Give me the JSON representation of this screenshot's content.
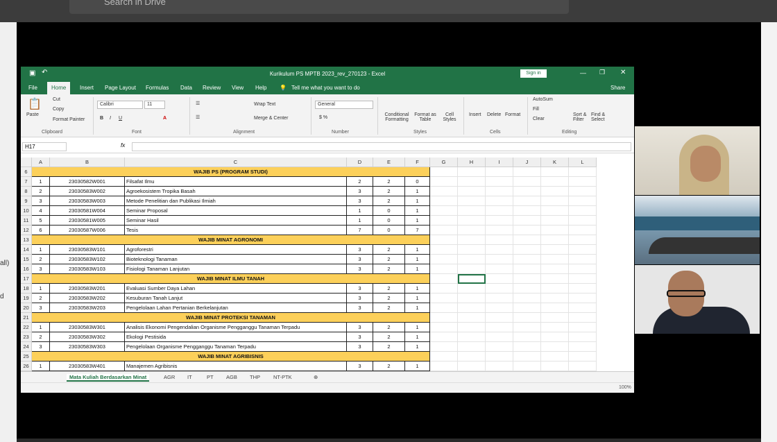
{
  "meet": {
    "search_placeholder": "Search in Drive",
    "left_labels": [
      "all)",
      "d"
    ]
  },
  "excel": {
    "title": "Kurikulum PS MPTB 2023_rev_270123 - Excel",
    "signin": "Sign in",
    "tabs": [
      "File",
      "Home",
      "Insert",
      "Page Layout",
      "Formulas",
      "Data",
      "Review",
      "View",
      "Help"
    ],
    "tell_me": "Tell me what you want to do",
    "share": "Share",
    "ribbon": {
      "paste": "Paste",
      "cut": "Cut",
      "copy": "Copy",
      "format_painter": "Format Painter",
      "font_name": "Calibri",
      "font_size": "11",
      "wrap_text": "Wrap Text",
      "merge_center": "Merge & Center",
      "number_format": "General",
      "conditional": "Conditional Formatting",
      "format_table": "Format as Table",
      "cell_styles": "Cell Styles",
      "insert": "Insert",
      "delete": "Delete",
      "format": "Format",
      "autosum": "AutoSum",
      "fill": "Fill",
      "clear": "Clear",
      "sort": "Sort & Filter",
      "find": "Find & Select",
      "groups": [
        "Clipboard",
        "Font",
        "Alignment",
        "Number",
        "Styles",
        "Cells",
        "Editing"
      ]
    },
    "namebox": "H17",
    "columns": [
      "A",
      "B",
      "C",
      "D",
      "E",
      "F",
      "G",
      "H",
      "I",
      "J",
      "K",
      "L"
    ],
    "rows": [
      {
        "n": "6",
        "section": "WAJIB PS (PROGRAM STUDI)"
      },
      {
        "n": "7",
        "a": "1",
        "b": "23030582W001",
        "c": "Filsafat Ilmu",
        "d": "2",
        "e": "2",
        "f": "0"
      },
      {
        "n": "8",
        "a": "2",
        "b": "23030583W002",
        "c": "Agroekosistem Tropika Basah",
        "d": "3",
        "e": "2",
        "f": "1"
      },
      {
        "n": "9",
        "a": "3",
        "b": "23030583W003",
        "c": "Metode Penelitian dan Publikasi Ilmiah",
        "d": "3",
        "e": "2",
        "f": "1"
      },
      {
        "n": "10",
        "a": "4",
        "b": "23030581W004",
        "c": "Seminar Proposal",
        "d": "1",
        "e": "0",
        "f": "1"
      },
      {
        "n": "11",
        "a": "5",
        "b": "23030581W005",
        "c": "Seminar Hasil",
        "d": "1",
        "e": "0",
        "f": "1"
      },
      {
        "n": "12",
        "a": "6",
        "b": "23030587W006",
        "c": "Tesis",
        "d": "7",
        "e": "0",
        "f": "7"
      },
      {
        "n": "13",
        "section": "WAJIB MINAT AGRONOMI"
      },
      {
        "n": "14",
        "a": "1",
        "b": "23030583W101",
        "c": "Agroforestri",
        "d": "3",
        "e": "2",
        "f": "1"
      },
      {
        "n": "15",
        "a": "2",
        "b": "23030583W102",
        "c": "Bioteknologi Tanaman",
        "d": "3",
        "e": "2",
        "f": "1"
      },
      {
        "n": "16",
        "a": "3",
        "b": "23030583W103",
        "c": "Fisiologi Tanaman Lanjutan",
        "d": "3",
        "e": "2",
        "f": "1"
      },
      {
        "n": "17",
        "section": "WAJIB MINAT ILMU TANAH"
      },
      {
        "n": "18",
        "a": "1",
        "b": "23030583W201",
        "c": "Evaluasi Sumber Daya Lahan",
        "d": "3",
        "e": "2",
        "f": "1"
      },
      {
        "n": "19",
        "a": "2",
        "b": "23030583W202",
        "c": "Kesuburan Tanah Lanjut",
        "d": "3",
        "e": "2",
        "f": "1"
      },
      {
        "n": "20",
        "a": "3",
        "b": "23030583W203",
        "c": "Pengelolaan Lahan Pertanian Berkelanjutan",
        "d": "3",
        "e": "2",
        "f": "1"
      },
      {
        "n": "21",
        "section": "WAJIB MINAT PROTEKSI TANAMAN"
      },
      {
        "n": "22",
        "a": "1",
        "b": "23030583W301",
        "c": "Analisis Ekonomi Pengendalian Organisme Pengganggu Tanaman Terpadu",
        "d": "3",
        "e": "2",
        "f": "1"
      },
      {
        "n": "23",
        "a": "2",
        "b": "23030583W302",
        "c": "Ekologi Pestisida",
        "d": "3",
        "e": "2",
        "f": "1"
      },
      {
        "n": "24",
        "a": "3",
        "b": "23030583W303",
        "c": "Pengelolaan Organisme Pengganggu Tanaman Terpadu",
        "d": "3",
        "e": "2",
        "f": "1"
      },
      {
        "n": "25",
        "section": "WAJIB MINAT AGRIBISNIS"
      },
      {
        "n": "26",
        "a": "1",
        "b": "23030583W401",
        "c": "Manajemen Agribisnis",
        "d": "3",
        "e": "2",
        "f": "1"
      }
    ],
    "sheets": [
      "Mata Kuliah Berdasarkan Minat",
      "AGR",
      "IT",
      "PT",
      "AGB",
      "THP",
      "NT-PTK"
    ],
    "zoom": "100%"
  }
}
